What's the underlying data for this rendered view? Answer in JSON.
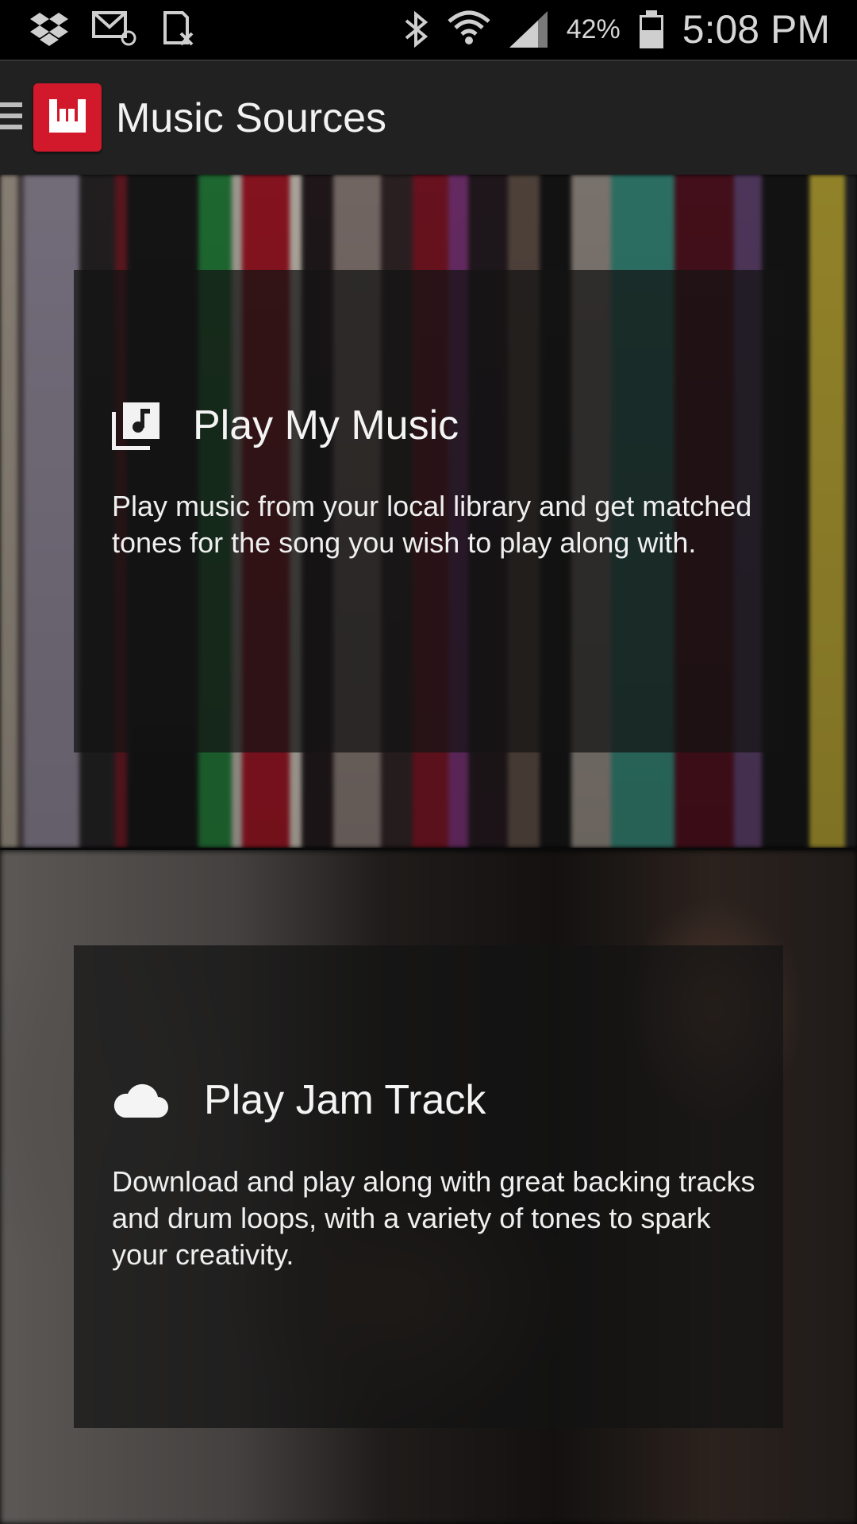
{
  "status_bar": {
    "battery_percent": "42%",
    "time": "5:08 PM",
    "icons_left": [
      "dropbox-icon",
      "email-icon",
      "sim-icon"
    ],
    "icons_right": [
      "bluetooth-icon",
      "wifi-icon",
      "signal-icon",
      "battery-icon"
    ]
  },
  "app_bar": {
    "title": "Music Sources",
    "menu_icon": "hamburger-menu-icon",
    "logo": "app-logo-icon"
  },
  "sources": [
    {
      "title": "Play My Music",
      "icon": "music-library-icon",
      "description": "Play music from your local library and get matched tones for the song you wish to play along with."
    },
    {
      "title": "Play Jam Track",
      "icon": "cloud-icon",
      "description": "Download and play along with great backing tracks and drum loops, with a variety of tones to spark your creativity."
    }
  ],
  "colors": {
    "accent": "#d2182b",
    "app_bar_bg": "#212121",
    "status_bar_bg": "#000000"
  }
}
